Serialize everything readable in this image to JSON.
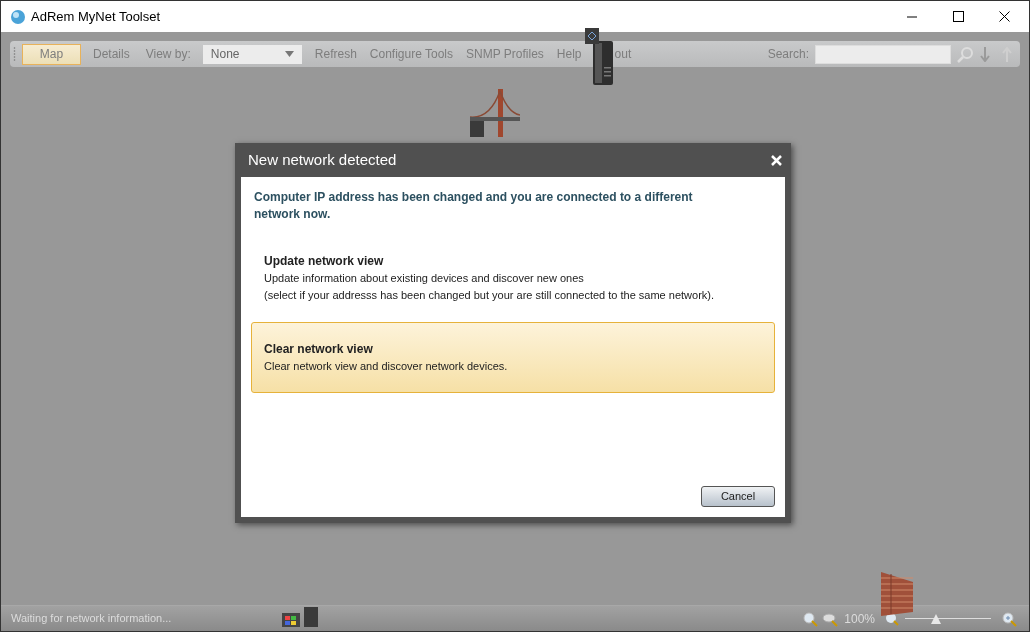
{
  "window": {
    "title": "AdRem MyNet Toolset"
  },
  "toolbar": {
    "items": [
      {
        "label": "Map",
        "selected": true
      },
      {
        "label": "Details",
        "selected": false
      }
    ],
    "view_by": {
      "label": "View by:",
      "value": "None"
    },
    "menu": [
      "Refresh",
      "Configure Tools",
      "SNMP Profiles",
      "Help",
      "out"
    ],
    "search": {
      "label": "Search:"
    }
  },
  "dialog": {
    "title": "New network detected",
    "message": "Computer IP address has been changed and you are connected to a different network now.",
    "options": [
      {
        "title": "Update network view",
        "lines": [
          "Update information about existing devices and discover new ones",
          "(select if your addresss has been changed but your are still connected to the same network)."
        ],
        "selected": false
      },
      {
        "title": "Clear network view",
        "lines": [
          "Clear network view and discover network devices."
        ],
        "selected": true
      }
    ],
    "cancel": "Cancel"
  },
  "status_bar": {
    "text": "Waiting for network information...",
    "zoom": "100%",
    "zoom_slider": {
      "level": 0.36
    }
  }
}
